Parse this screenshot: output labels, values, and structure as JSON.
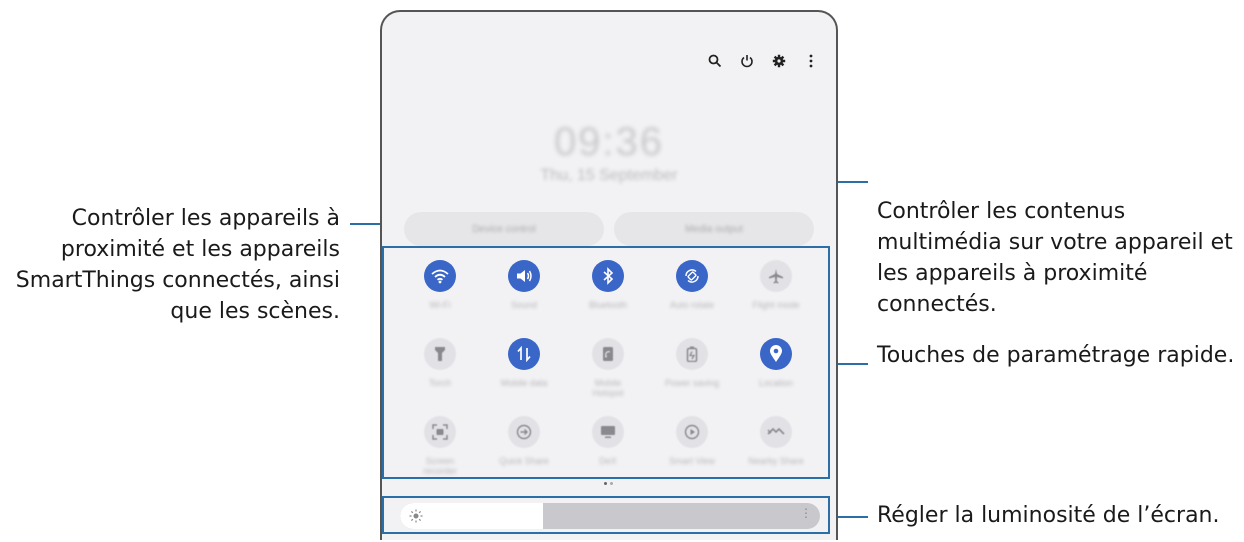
{
  "callouts": {
    "devices": "Contrôler les appareils à proximité et les appareils SmartThings connectés, ainsi que les scènes.",
    "media": "Contrôler les contenus multimédia sur votre appareil et les appareils à proximité connectés.",
    "quick_settings": "Touches de paramétrage rapide.",
    "brightness": "Régler la luminosité de l’écran."
  },
  "panel": {
    "top_icons": [
      "search-icon",
      "power-icon",
      "settings-icon",
      "more-icon"
    ],
    "clock": "09:36",
    "date": "Thu, 15 September",
    "device_control_label": "Device control",
    "media_output_label": "Media output"
  },
  "quick_tiles": [
    {
      "icon": "wifi-icon",
      "label": "Wi-Fi",
      "active": true
    },
    {
      "icon": "sound-icon",
      "label": "Sound",
      "active": true
    },
    {
      "icon": "bluetooth-icon",
      "label": "Bluetooth",
      "active": true
    },
    {
      "icon": "auto-rotate-icon",
      "label": "Auto rotate",
      "active": true
    },
    {
      "icon": "airplane-icon",
      "label": "Flight mode",
      "active": false
    },
    {
      "icon": "flashlight-icon",
      "label": "Torch",
      "active": false
    },
    {
      "icon": "mobile-data-icon",
      "label": "Mobile data",
      "active": true
    },
    {
      "icon": "hotspot-icon",
      "label": "Mobile Hotspot",
      "active": false
    },
    {
      "icon": "power-saving-icon",
      "label": "Power saving",
      "active": false
    },
    {
      "icon": "location-icon",
      "label": "Location",
      "active": true
    },
    {
      "icon": "screen-recorder-icon",
      "label": "Screen recorder",
      "active": false
    },
    {
      "icon": "quick-share-icon",
      "label": "Quick Share",
      "active": false
    },
    {
      "icon": "dex-icon",
      "label": "DeX",
      "active": false
    },
    {
      "icon": "smart-view-icon",
      "label": "Smart View",
      "active": false
    },
    {
      "icon": "nearby-share-icon",
      "label": "Nearby Share",
      "active": false
    }
  ],
  "brightness": {
    "level": 0.34
  },
  "colors": {
    "accent": "#3a66c8",
    "callout_line": "#2a6fa8"
  }
}
